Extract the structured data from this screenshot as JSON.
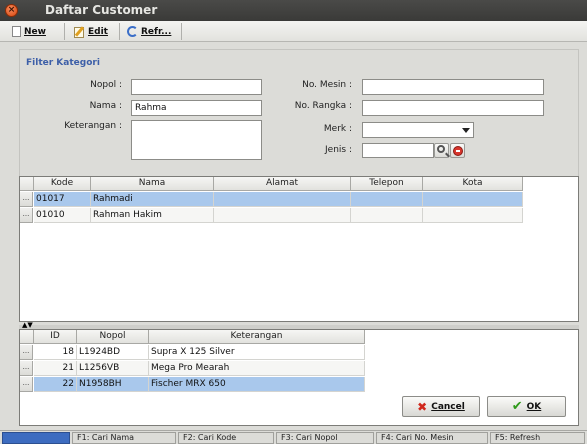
{
  "window": {
    "title": "Daftar Customer"
  },
  "toolbar": {
    "new_label": "New",
    "edit_label": "Edit",
    "refresh_label": "Refr..."
  },
  "filter": {
    "title": "Filter Kategori",
    "nopol_label": "Nopol :",
    "nopol_value": "",
    "nama_label": "Nama :",
    "nama_value": "Rahma",
    "keterangan_label": "Keterangan :",
    "keterangan_value": "",
    "mesin_label": "No. Mesin :",
    "mesin_value": "",
    "rangka_label": "No. Rangka :",
    "rangka_value": "",
    "merk_label": "Merk :",
    "merk_value": "",
    "jenis_label": "Jenis :",
    "jenis_value": ""
  },
  "customer_table": {
    "columns": [
      "Kode",
      "Nama",
      "Alamat",
      "Telepon",
      "Kota"
    ],
    "rows": [
      {
        "kode": "01017",
        "nama": "Rahmadi",
        "alamat": "",
        "telepon": "",
        "kota": ""
      },
      {
        "kode": "01010",
        "nama": "Rahman Hakim",
        "alamat": "",
        "telepon": "",
        "kota": ""
      }
    ],
    "row_header": "..."
  },
  "vehicle_table": {
    "columns": [
      "ID",
      "Nopol",
      "Keterangan"
    ],
    "rows": [
      {
        "id": "18",
        "nopol": "L1924BD",
        "keterangan": "Supra X 125 Silver"
      },
      {
        "id": "21",
        "nopol": "L1256VB",
        "keterangan": "Mega Pro Mearah"
      },
      {
        "id": "22",
        "nopol": "N1958BH",
        "keterangan": "Fischer MRX 650"
      }
    ],
    "row_header": "..."
  },
  "buttons": {
    "cancel_label": "Cancel",
    "ok_label": "OK"
  },
  "statusbar": {
    "items": [
      "",
      "F1: Cari Nama",
      "F2: Cari Kode",
      "F3: Cari Nopol",
      "F4: Cari No. Mesin",
      "F5: Refresh"
    ]
  },
  "colors": {
    "selection": "#a9c8ec",
    "accent": "#3d5fa8",
    "titlebar": "#3c3c3a"
  },
  "icons": [
    "close-icon",
    "new-icon",
    "edit-icon",
    "refresh-icon",
    "search-icon",
    "clear-icon",
    "cancel-icon",
    "ok-icon",
    "dropdown-icon"
  ]
}
